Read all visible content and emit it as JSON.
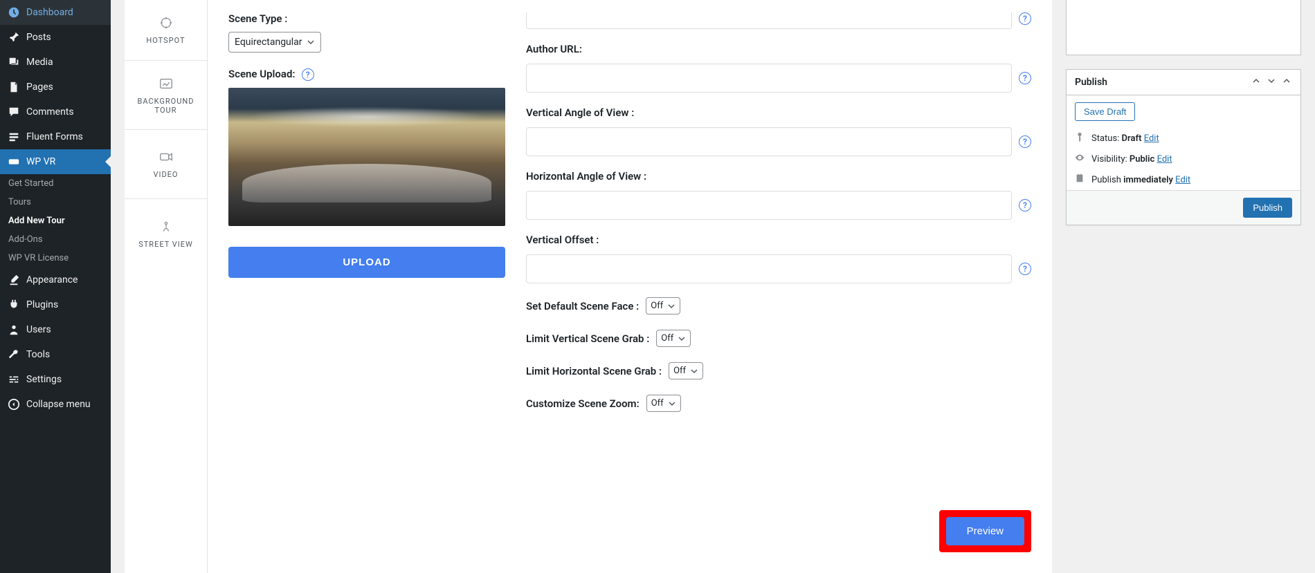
{
  "sidebar": {
    "dashboard": "Dashboard",
    "posts": "Posts",
    "media": "Media",
    "pages": "Pages",
    "comments": "Comments",
    "fluent_forms": "Fluent Forms",
    "wp_vr": "WP VR",
    "submenu": {
      "get_started": "Get Started",
      "tours": "Tours",
      "add_new_tour": "Add New Tour",
      "add_ons": "Add-Ons",
      "wp_vr_license": "WP VR License"
    },
    "appearance": "Appearance",
    "plugins": "Plugins",
    "users": "Users",
    "tools": "Tools",
    "settings": "Settings",
    "collapse": "Collapse menu"
  },
  "tabs": {
    "hotspot": "HOTSPOT",
    "background_tour": "BACKGROUND TOUR",
    "video": "VIDEO",
    "street_view": "STREET VIEW"
  },
  "left": {
    "scene_type_label": "Scene Type :",
    "scene_type_value": "Equirectangular",
    "scene_upload_label": "Scene Upload:",
    "upload_btn": "UPLOAD"
  },
  "right": {
    "author_url": "Author URL:",
    "vaov": "Vertical Angle of View :",
    "haov": "Horizontal Angle of View :",
    "voffset": "Vertical Offset :",
    "default_face": "Set Default Scene Face :",
    "limit_v": "Limit Vertical Scene Grab :",
    "limit_h": "Limit Horizontal Scene Grab :",
    "zoom": "Customize Scene Zoom:",
    "off": "Off"
  },
  "preview": "Preview",
  "publish": {
    "title": "Publish",
    "save_draft": "Save Draft",
    "status_label": "Status: ",
    "status_value": "Draft",
    "visibility_label": "Visibility: ",
    "visibility_value": "Public",
    "publish_label": "Publish ",
    "publish_value": "immediately",
    "edit": "Edit",
    "btn": "Publish"
  }
}
